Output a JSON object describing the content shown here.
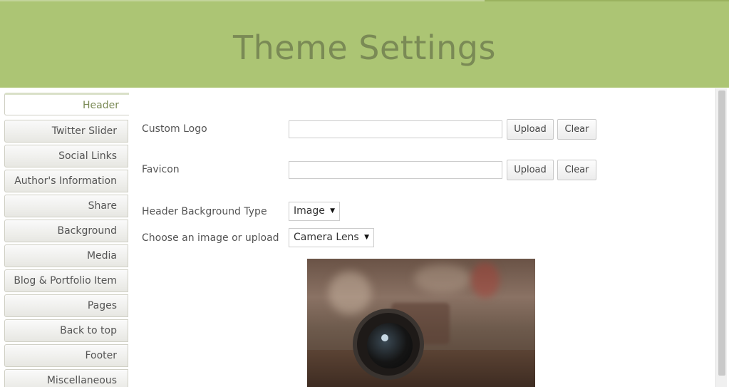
{
  "page": {
    "title": "Theme Settings"
  },
  "sidebar": {
    "items": [
      {
        "label": "Header",
        "active": true
      },
      {
        "label": "Twitter Slider"
      },
      {
        "label": "Social Links"
      },
      {
        "label": "Author's Information"
      },
      {
        "label": "Share"
      },
      {
        "label": "Background"
      },
      {
        "label": "Media"
      },
      {
        "label": "Blog & Portfolio Item"
      },
      {
        "label": "Pages"
      },
      {
        "label": "Back to top"
      },
      {
        "label": "Footer"
      },
      {
        "label": "Miscellaneous"
      }
    ]
  },
  "form": {
    "custom_logo": {
      "label": "Custom Logo",
      "value": "",
      "upload": "Upload",
      "clear": "Clear"
    },
    "favicon": {
      "label": "Favicon",
      "value": "",
      "upload": "Upload",
      "clear": "Clear"
    },
    "header_bg_type": {
      "label": "Header Background Type",
      "selected": "Image"
    },
    "image_choice": {
      "label": "Choose an image or upload",
      "selected": "Camera Lens"
    }
  },
  "colors": {
    "header_band": "#acc574",
    "title_text": "#7a8a55",
    "active_tab_text": "#7a8a55"
  },
  "icons": {
    "select_caret": "▼"
  }
}
